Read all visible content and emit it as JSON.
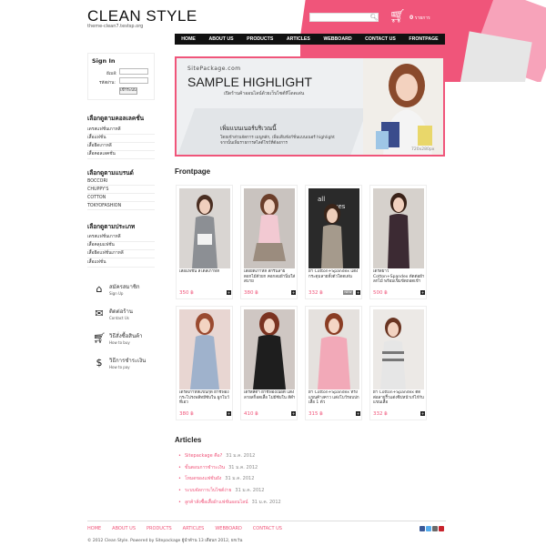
{
  "header": {
    "logo": "CLEAN STYLE",
    "logo_sub": "theme-clean7.testsp.org",
    "cart_count": "0",
    "cart_unit": "รายการ"
  },
  "nav": [
    "HOME",
    "ABOUT US",
    "PRODUCTS",
    "ARTICLES",
    "WEBBOARD",
    "CONTACT US",
    "FRONTPAGE"
  ],
  "banner": {
    "site": "SitePackage.com",
    "headline": "SAMPLE HIGHLIGHT",
    "subline": "เปิดร้านค้าออนไลน์ด้วยเว็บไซต์ที่โดดเด่น",
    "promo": "เพิ่มแบนเนอร์บริเวณนี้",
    "promo_line1": "โดยเข้าส่วนจัดการ เมนูหลัก, เพิ่มเติมฟังก์ชั่นแบนเนอร์ highlight",
    "promo_line2": "จากนั้นเพิ่มรายการสไลด์โชว์ที่ต้องการ",
    "size_note": "720x280px"
  },
  "signin": {
    "title": "Sign In",
    "email_label": "อีเมล์:",
    "password_label": "รหัสผ่าน:",
    "button": "เข้าระบบ"
  },
  "categories": [
    {
      "title": "เลือกดูตามคอลเลคชั่น",
      "items": [
        "เดรสแฟชั่นเกาหลี",
        "เสื้อแฟชั่น",
        "เสื้อยืดเกาหลี",
        "เสื้อคอลเลคชั่น"
      ]
    },
    {
      "title": "เลือกดูตามแบรนด์",
      "items": [
        "BOCCORI",
        "CHUPPY'S",
        "COTTON",
        "TOKYOFASHION"
      ]
    },
    {
      "title": "เลือกดูตามประเภท",
      "items": [
        "เดรสแฟชั่นเกาหลี",
        "เสื้อคลุมแฟชั่น",
        "เสื้อยืดแฟชั่นเกาหลี",
        "เสื้อแฟชั่น"
      ]
    }
  ],
  "side_links": [
    {
      "th": "สมัครสมาชิก",
      "en": "Sign Up",
      "icon": "home-icon"
    },
    {
      "th": "ติดต่อร้าน",
      "en": "Contact Us",
      "icon": "mail-icon"
    },
    {
      "th": "วิธีสั่งซื้อสินค้า",
      "en": "How to buy",
      "icon": "cart-icon"
    },
    {
      "th": "วิธีการชำระเงิน",
      "en": "How to pay",
      "icon": "dollar-icon"
    }
  ],
  "frontpage": {
    "title": "Frontpage",
    "products": [
      {
        "name": "เสื้อแฟชั่น สไตล์เกาหลี",
        "price": "350 ฿",
        "new": false
      },
      {
        "name": "เสื้อยืดเกาหลี สกรีนลายดอกไม้ตัวยก คอกลมผ้านิ่มใส่สบาย",
        "price": "380 ฿",
        "new": false
      },
      {
        "name": "ผ้า Cotton+Spandex แต่งกระดุมลายทั้งตัวโดดเด่น",
        "price": "332 ฿",
        "new": true,
        "new_label": "NEW"
      },
      {
        "name": "เดรสยาว Cotton+Spandex ตัดต่อผ้าลูกไม้ พร้อมเข็มขัดถอดเข้าเข็มกลัด",
        "price": "500 ฿",
        "new": false
      },
      {
        "name": "เดรสเกาหลีแขนกุด ผ้าชีฟอง กระโปรงพลีทมีซับใน ผูกโบว์ที่เอว",
        "price": "380 ฿",
        "new": false
      },
      {
        "name": "เดรสสีดำ ผ้าชีฟองเนื้อดี แต่งลายสก็อตเสื้อ ไม่มีซับใน สีดำ",
        "price": "410 ฿",
        "new": false
      },
      {
        "name": "ผ้า Cotton+Spandex ทรงแขนค้างคาว แต่งโบว์รอบปกเสื้อ 1 ตัว",
        "price": "315 ฿",
        "new": false
      },
      {
        "name": "ผ้า Cotton+Spandex ตัดต่อลายริ้วแต่งซิปหน้าเก๋ไก๋กับแขนเสื้อ",
        "price": "332 ฿",
        "new": false
      }
    ]
  },
  "articles": {
    "title": "Articles",
    "items": [
      {
        "title": "Sitepackage คือ?",
        "date": "31 ม.ค. 2012"
      },
      {
        "title": "ขั้นตอนการชำระเงิน",
        "date": "31 ม.ค. 2012"
      },
      {
        "title": "โหมดของแฟชั่นยัง",
        "date": "31 ม.ค. 2012"
      },
      {
        "title": "ระบบจัดการเว็บไซต์ง่าย",
        "date": "31 ม.ค. 2012"
      },
      {
        "title": "ลูกค้าสั่งซื้อเสื้อผ้าแฟชั่นออนไลน์",
        "date": "31 ม.ค. 2012"
      }
    ]
  },
  "footer": {
    "nav": [
      "HOME",
      "ABOUT US",
      "PRODUCTS",
      "ARTICLES",
      "WEBBOARD",
      "CONTACT US"
    ],
    "copyright": "© 2012 Clean Style. Powered by Sitepackage ผู้นำด้าน 13 เดือนก 2012, ยกเว้น"
  },
  "colors": {
    "accent": "#f0557a",
    "nav_bg": "#111111"
  }
}
